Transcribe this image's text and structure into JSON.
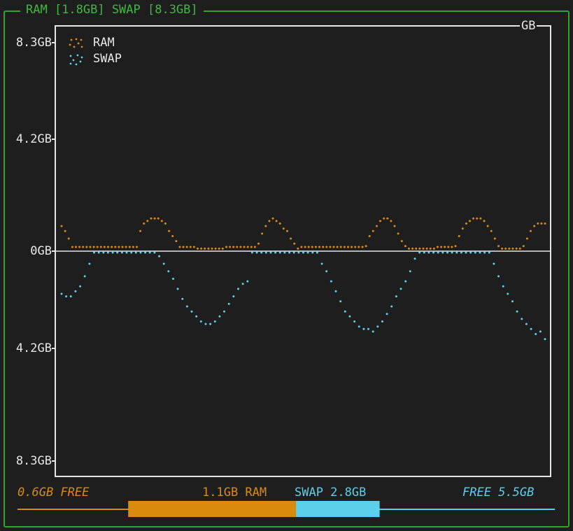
{
  "panel": {
    "title": "RAM [1.8GB] SWAP [8.3GB]",
    "frame_color": "#2fa52f"
  },
  "chart_data": {
    "type": "line",
    "unit_label": "GB",
    "y_tick_labels": [
      "8.3GB",
      "4.2GB",
      "0GB",
      "4.2GB",
      "8.3GB"
    ],
    "ylim": [
      -8.3,
      8.3
    ],
    "legend": {
      "placement": "top-left",
      "entries": [
        "RAM",
        "SWAP"
      ]
    },
    "grid": false,
    "series": [
      {
        "name": "RAM",
        "color": "#d98b10",
        "direction": "up",
        "values": [
          1.0,
          0.8,
          0.5,
          0,
          0,
          0,
          0,
          0,
          0,
          0,
          0,
          0,
          0,
          0,
          0,
          0,
          0,
          0,
          0,
          0,
          0,
          0,
          0.8,
          1.1,
          1.2,
          1.3,
          1.3,
          1.3,
          1.2,
          1.1,
          0.8,
          0.6,
          0.4,
          0,
          0,
          0,
          0,
          0,
          0.1,
          0.1,
          0.1,
          0.1,
          0.1,
          0.1,
          0.1,
          0.1,
          0,
          0,
          0,
          0,
          0,
          0,
          0,
          0,
          0,
          0.3,
          0.7,
          1.0,
          1.2,
          1.3,
          1.2,
          1.1,
          0.9,
          0.8,
          0.5,
          0.3,
          0.1,
          0,
          0,
          0,
          0,
          0,
          0,
          0,
          0,
          0,
          0,
          0,
          0,
          0,
          0,
          0,
          0,
          0,
          0,
          0.2,
          0.6,
          0.8,
          1.0,
          1.2,
          1.3,
          1.3,
          1.2,
          1.0,
          0.7,
          0.4,
          0.2,
          0.1,
          0.1,
          0.1,
          0.1,
          0.1,
          0.1,
          0.1,
          0.1,
          0,
          0,
          0,
          0,
          0,
          0.2,
          0.6,
          0.9,
          1.1,
          1.2,
          1.3,
          1.3,
          1.3,
          1.2,
          1.0,
          0.8,
          0.5,
          0.2,
          0.1,
          0.1,
          0.1,
          0.1,
          0.1,
          0.1,
          0.2,
          0.5,
          0.8,
          1.0,
          1.1,
          1.1,
          1.1
        ]
      },
      {
        "name": "SWAP",
        "color": "#5bd0eb",
        "direction": "down",
        "values": [
          1.7,
          1.8,
          1.8,
          1.6,
          1.4,
          1.0,
          0.5,
          0,
          0,
          0,
          0,
          0,
          0,
          0,
          0,
          0,
          0,
          0,
          0,
          0,
          0,
          0.2,
          0.5,
          0.8,
          1.1,
          1.5,
          1.9,
          2.2,
          2.4,
          2.6,
          2.8,
          2.9,
          2.9,
          2.8,
          2.6,
          2.4,
          2.1,
          1.8,
          1.5,
          1.3,
          1.2,
          0,
          0,
          0,
          0,
          0,
          0,
          0,
          0,
          0,
          0,
          0,
          0,
          0,
          0,
          0,
          0.5,
          0.8,
          1.2,
          1.6,
          2.0,
          2.4,
          2.6,
          2.8,
          3.0,
          3.1,
          3.1,
          3.2,
          3.0,
          2.8,
          2.5,
          2.2,
          1.8,
          1.5,
          1.2,
          0.8,
          0.3,
          0,
          0,
          0,
          0,
          0,
          0,
          0,
          0,
          0,
          0,
          0,
          0,
          0,
          0,
          0,
          0,
          0.5,
          1.0,
          1.4,
          1.7,
          2.0,
          2.4,
          2.7,
          2.9,
          3.1,
          3.3,
          3.2,
          3.5
        ]
      }
    ]
  },
  "footer": {
    "free_left": "0.6GB FREE",
    "ram_used": "1.1GB RAM",
    "swap_used": "SWAP 2.8GB",
    "free_right": "FREE 5.5GB",
    "usage_bar": {
      "free_left_fraction": 0.206,
      "ram_fraction": 0.312,
      "swap_fraction": 0.156,
      "free_right_fraction": 0.326
    },
    "ram_color": "#d98b10",
    "swap_color": "#5bd0eb"
  }
}
